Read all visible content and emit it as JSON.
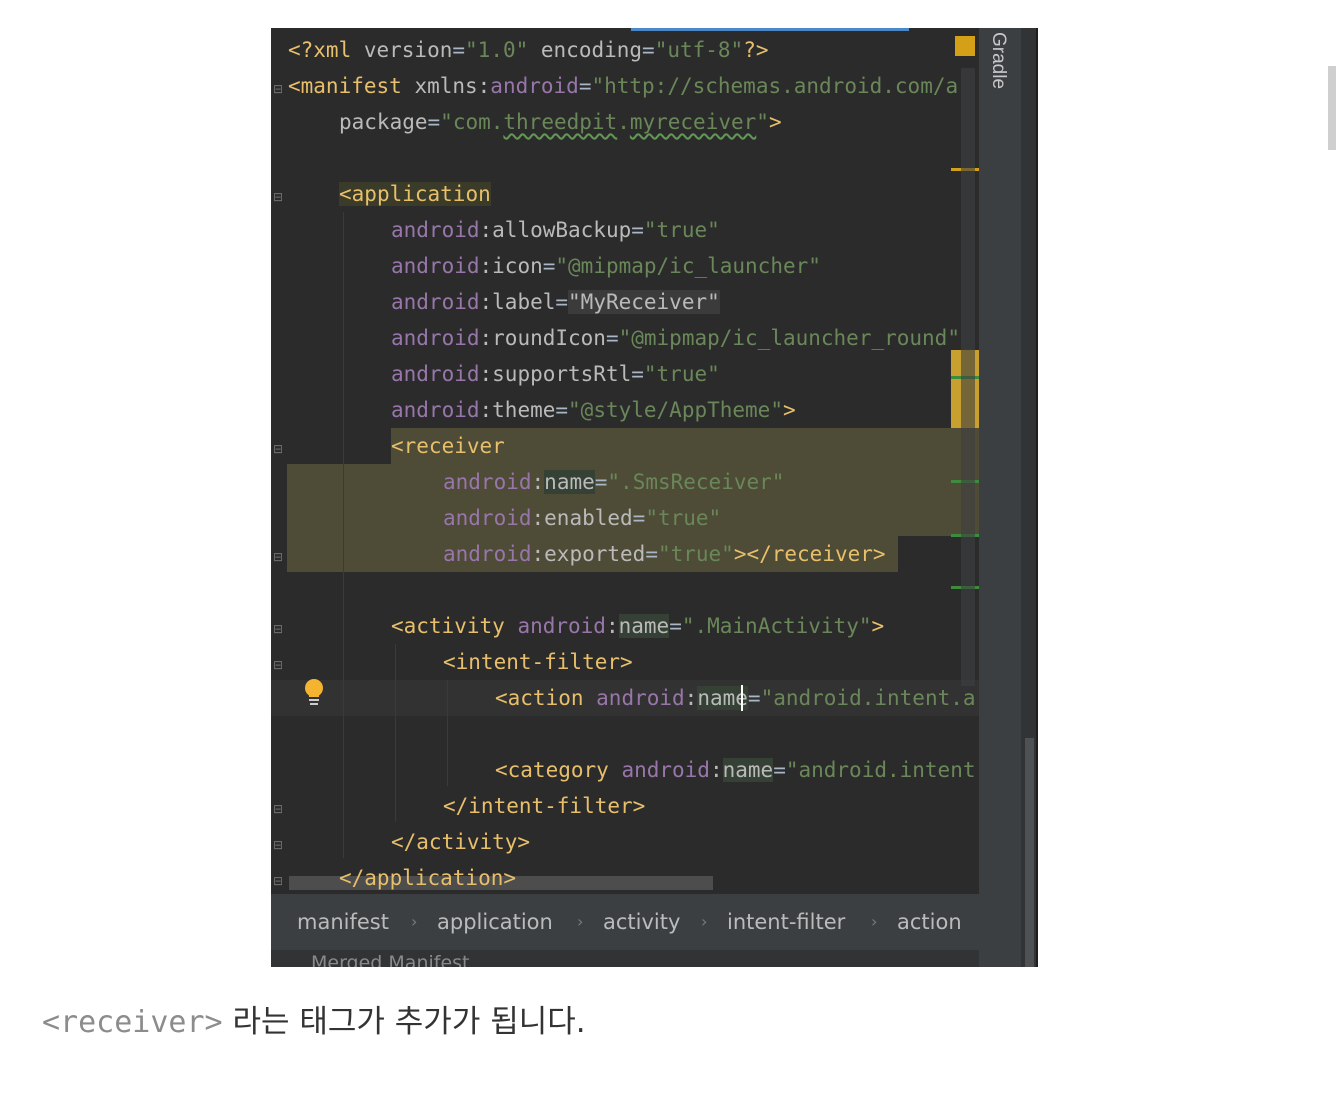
{
  "editor": {
    "lines": {
      "l1": {
        "p1": "<?xml ",
        "p2": "version",
        "p3": "=",
        "p4": "\"1.0\"",
        "p5": " encoding",
        "p6": "=",
        "p7": "\"utf-8\"",
        "p8": "?>"
      },
      "l2": {
        "p1": "<manifest ",
        "p2": "xmlns:",
        "p3": "android",
        "p4": "=",
        "p5": "\"http://schemas.android.com/a"
      },
      "l3": {
        "p1": "package",
        "p2": "=",
        "p3": "\"com.",
        "p4": "threedpit",
        "p5": ".",
        "p6": "myreceiver",
        "p7": "\"",
        "p8": ">"
      },
      "l5": {
        "p1": "<",
        "p2": "application"
      },
      "l6": {
        "p1": "android",
        "p2": ":allowBackup",
        "p3": "=",
        "p4": "\"true\""
      },
      "l7": {
        "p1": "android",
        "p2": ":icon",
        "p3": "=",
        "p4": "\"@mipmap/ic_launcher\""
      },
      "l8": {
        "p1": "android",
        "p2": ":label",
        "p3": "=",
        "p4": "\"MyReceiver\""
      },
      "l9": {
        "p1": "android",
        "p2": ":roundIcon",
        "p3": "=",
        "p4": "\"@mipmap/ic_launcher_round\""
      },
      "l10": {
        "p1": "android",
        "p2": ":supportsRtl",
        "p3": "=",
        "p4": "\"true\""
      },
      "l11": {
        "p1": "android",
        "p2": ":theme",
        "p3": "=",
        "p4": "\"@style/AppTheme\"",
        "p5": ">"
      },
      "l12": {
        "p1": "<receiver"
      },
      "l13": {
        "p1": "android",
        "p2": ":",
        "p3": "name",
        "p4": "=",
        "p5": "\".SmsReceiver\""
      },
      "l14": {
        "p1": "android",
        "p2": ":enabled",
        "p3": "=",
        "p4": "\"true\""
      },
      "l15": {
        "p1": "android",
        "p2": ":exported",
        "p3": "=",
        "p4": "\"true\"",
        "p5": "></receiver>"
      },
      "l17": {
        "p1": "<activity ",
        "p2": "android",
        "p3": ":",
        "p4": "name",
        "p5": "=",
        "p6": "\".MainActivity\"",
        "p7": ">"
      },
      "l18": {
        "p1": "<intent-filter>"
      },
      "l19": {
        "p1": "<action ",
        "p2": "android",
        "p3": ":",
        "p4": "na",
        "p5": "me",
        "p6": "=",
        "p7": "\"android.intent.a"
      },
      "l21": {
        "p1": "<category ",
        "p2": "android",
        "p3": ":",
        "p4": "name",
        "p5": "=",
        "p6": "\"android.intent"
      },
      "l22": {
        "p1": "</intent-filter>"
      },
      "l23": {
        "p1": "</activity>"
      },
      "l24": {
        "p1": "</application>"
      }
    }
  },
  "side_panel": {
    "gradle_label": "Gradle"
  },
  "breadcrumb": {
    "items": [
      "manifest",
      "application",
      "activity",
      "intent-filter",
      "action"
    ],
    "separator": "›",
    "bottom_tab_label": "Merged Manifest"
  },
  "caption": {
    "code": "<receiver>",
    "text": " 라는 태그가 추가가 됩니다."
  },
  "colors": {
    "editor_bg": "#2b2b2b",
    "tag": "#e8bf6a",
    "attribute_namespace": "#9876aa",
    "string": "#6a8759",
    "text": "#a9b7c6",
    "inserted_block": "#4e4b37",
    "marker_yellow": "#d4a017"
  },
  "icons": {
    "intention_bulb": "lightbulb-icon",
    "fold_markers": "fold-arrow-icon"
  }
}
